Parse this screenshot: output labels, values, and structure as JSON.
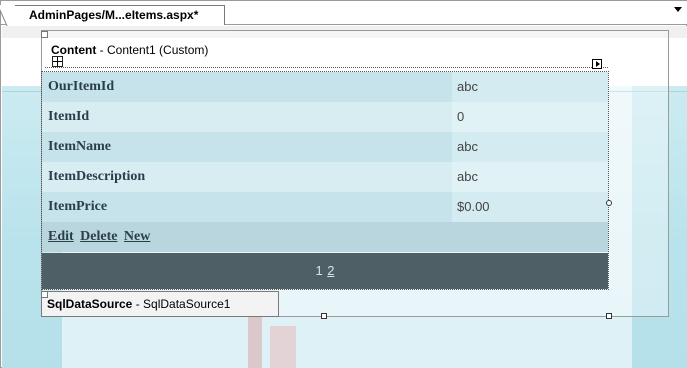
{
  "tab": {
    "title": "AdminPages/M...eItems.aspx*"
  },
  "content": {
    "control_name": "Content",
    "control_desc": " - Content1 (Custom)"
  },
  "details_view": {
    "fields": [
      {
        "label": "OurItemId",
        "value": "abc"
      },
      {
        "label": "ItemId",
        "value": "0"
      },
      {
        "label": "ItemName",
        "value": "abc"
      },
      {
        "label": "ItemDescription",
        "value": "abc"
      },
      {
        "label": "ItemPrice",
        "value": "$0.00"
      }
    ],
    "commands": [
      "Edit",
      "Delete",
      "New"
    ],
    "pager": {
      "current": "1",
      "link": "2"
    }
  },
  "datasource": {
    "control_name": "SqlDataSource",
    "control_desc": " - SqlDataSource1"
  },
  "colors": {
    "field_row_a": "#c6e2ea",
    "field_row_b": "#d7edf2",
    "command_row": "#b9d5de",
    "pager_bg": "#4e5f66",
    "label_text": "#2b3f4a"
  }
}
